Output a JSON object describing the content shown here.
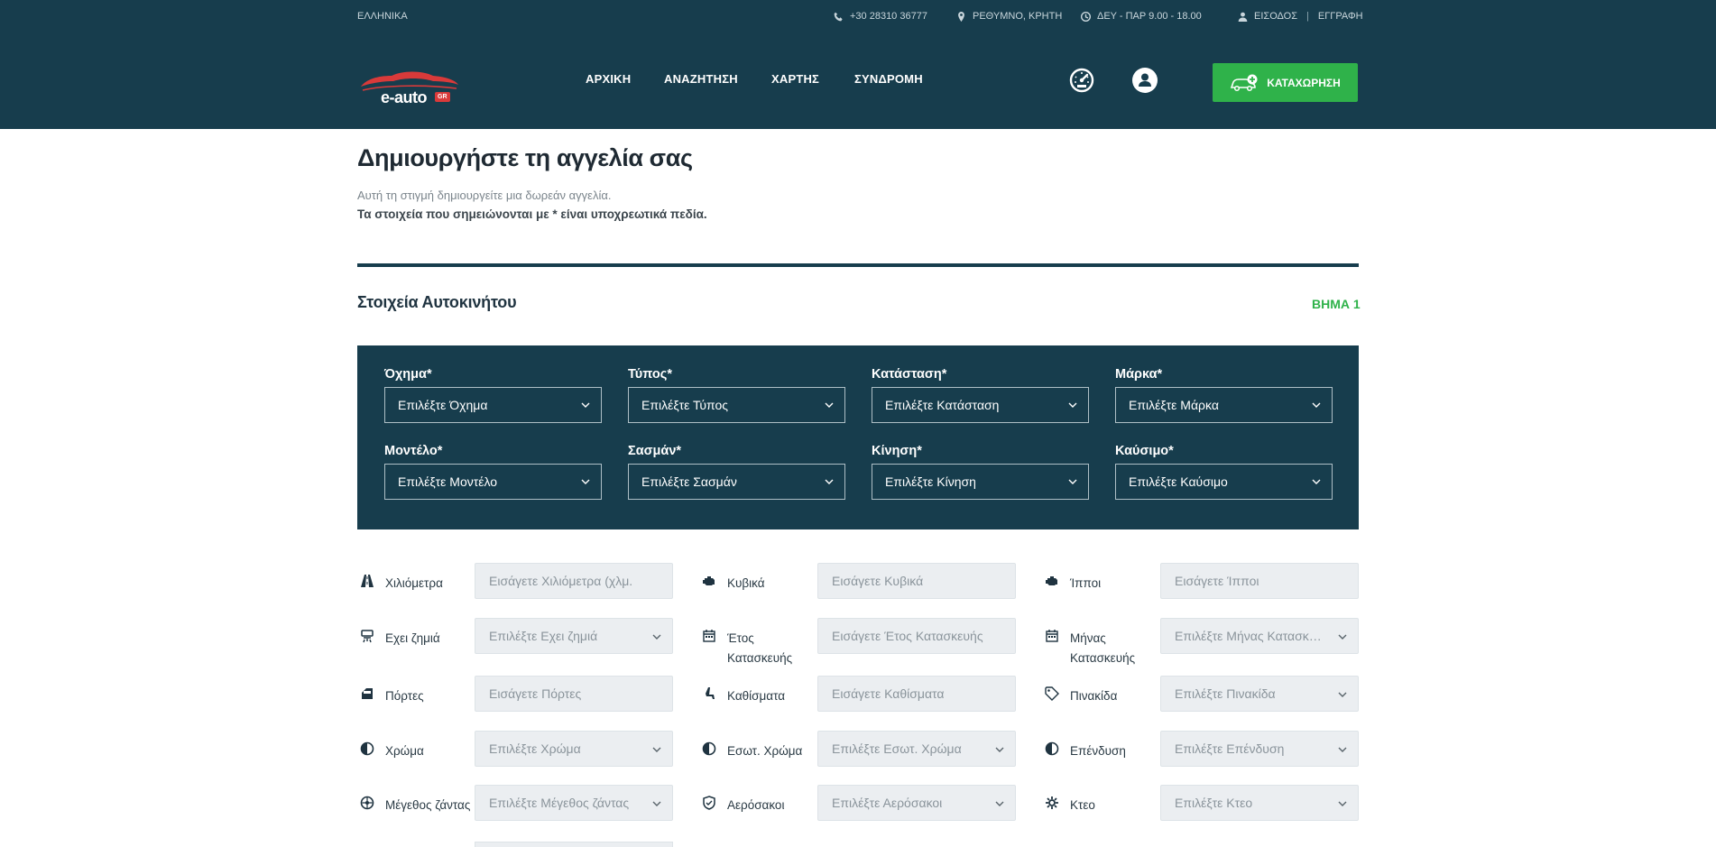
{
  "topbar": {
    "language": "ΕΛΛΗΝΙΚΑ",
    "phone": "+30 28310 36777",
    "location": "ΡΕΘΥΜΝΟ, ΚΡΗΤΗ",
    "hours": "ΔΕΥ - ΠΑΡ 9.00 - 18.00",
    "login": "ΕΙΣΟΔΟΣ",
    "separator": "|",
    "register": "ΕΓΓΡΑΦΗ"
  },
  "logo": {
    "text": "e-auto",
    "badge": "GR"
  },
  "nav": [
    "ΑΡΧΙΚΗ",
    "ΑΝΑΖΗΤΗΣΗ",
    "ΧΑΡΤΗΣ",
    "ΣΥΝΔΡΟΜΗ"
  ],
  "cta": {
    "label": "ΚΑΤΑΧΩΡΗΣΗ"
  },
  "intro": {
    "title": "Δημιουργήστε τη αγγελία σας",
    "line1": "Αυτή τη στιγμή δημιουργείτε μια δωρεάν αγγελία.",
    "line2": "Τα στοιχεία που σημειώνονται με * είναι υποχρεωτικά πεδία."
  },
  "section": {
    "title": "Στοιχεία Αυτοκινήτου",
    "step": "ΒΗΜΑ 1"
  },
  "panel_fields": [
    {
      "label": "Όχημα*",
      "value": "Επιλέξτε Όχημα"
    },
    {
      "label": "Τύπος*",
      "value": "Επιλέξτε Τύπος"
    },
    {
      "label": "Κατάσταση*",
      "value": "Επιλέξτε Κατάσταση"
    },
    {
      "label": "Μάρκα*",
      "value": "Επιλέξτε Μάρκα"
    },
    {
      "label": "Μοντέλο*",
      "value": "Επιλέξτε Μοντέλο"
    },
    {
      "label": "Σασμάν*",
      "value": "Επιλέξτε Σασμάν"
    },
    {
      "label": "Κίνηση*",
      "value": "Επιλέξτε Κίνηση"
    },
    {
      "label": "Καύσιμο*",
      "value": "Επιλέξτε Καύσιμο"
    }
  ],
  "spec_fields": [
    {
      "label": "Χιλιόμετρα",
      "placeholder": "Εισάγετε Χιλιόμετρα (χλμ.",
      "icon": "road-icon",
      "kind": "input"
    },
    {
      "label": "Κυβικά",
      "placeholder": "Εισάγετε Κυβικά",
      "icon": "engine-icon",
      "kind": "input"
    },
    {
      "label": "Ίπποι",
      "placeholder": "Εισάγετε Ίπποι",
      "icon": "engine-icon",
      "kind": "input"
    },
    {
      "label": "Εχει ζημιά",
      "placeholder": "Επιλέξτε Εχει ζημιά",
      "icon": "car-damage-icon",
      "kind": "select"
    },
    {
      "label": "Έτος Κατασκευής",
      "placeholder": "Εισάγετε Έτος Κατασκευής",
      "icon": "calendar-icon",
      "kind": "input"
    },
    {
      "label": "Μήνας Κατασκευής",
      "placeholder": "Επιλέξτε Μήνας Κατασκευής",
      "icon": "calendar-icon",
      "kind": "select"
    },
    {
      "label": "Πόρτες",
      "placeholder": "Εισάγετε Πόρτες",
      "icon": "door-icon",
      "kind": "input"
    },
    {
      "label": "Καθίσματα",
      "placeholder": "Εισάγετε Καθίσματα",
      "icon": "seat-icon",
      "kind": "input"
    },
    {
      "label": "Πινακίδα",
      "placeholder": "Επιλέξτε Πινακίδα",
      "icon": "tag-icon",
      "kind": "select"
    },
    {
      "label": "Χρώμα",
      "placeholder": "Επιλέξτε Χρώμα",
      "icon": "color-icon",
      "kind": "select"
    },
    {
      "label": "Εσωτ. Χρώμα",
      "placeholder": "Επιλέξτε Εσωτ. Χρώμα",
      "icon": "color-icon",
      "kind": "select"
    },
    {
      "label": "Επένδυση",
      "placeholder": "Επιλέξτε Επένδυση",
      "icon": "color-icon",
      "kind": "select"
    },
    {
      "label": "Μέγεθος ζάντας",
      "placeholder": "Επιλέξτε Μέγεθος ζάντας",
      "icon": "wheel-icon",
      "kind": "select"
    },
    {
      "label": "Αερόσακοι",
      "placeholder": "Επιλέξτε Αερόσακοι",
      "icon": "shield-icon",
      "kind": "select"
    },
    {
      "label": "Κτεο",
      "placeholder": "Επιλέξτε Κτεο",
      "icon": "gear-icon",
      "kind": "select"
    }
  ],
  "colors": {
    "header": "#173d4d",
    "accent": "#2fb24a",
    "logo_red": "#d93a3a",
    "field_bg": "#ebeef1"
  }
}
